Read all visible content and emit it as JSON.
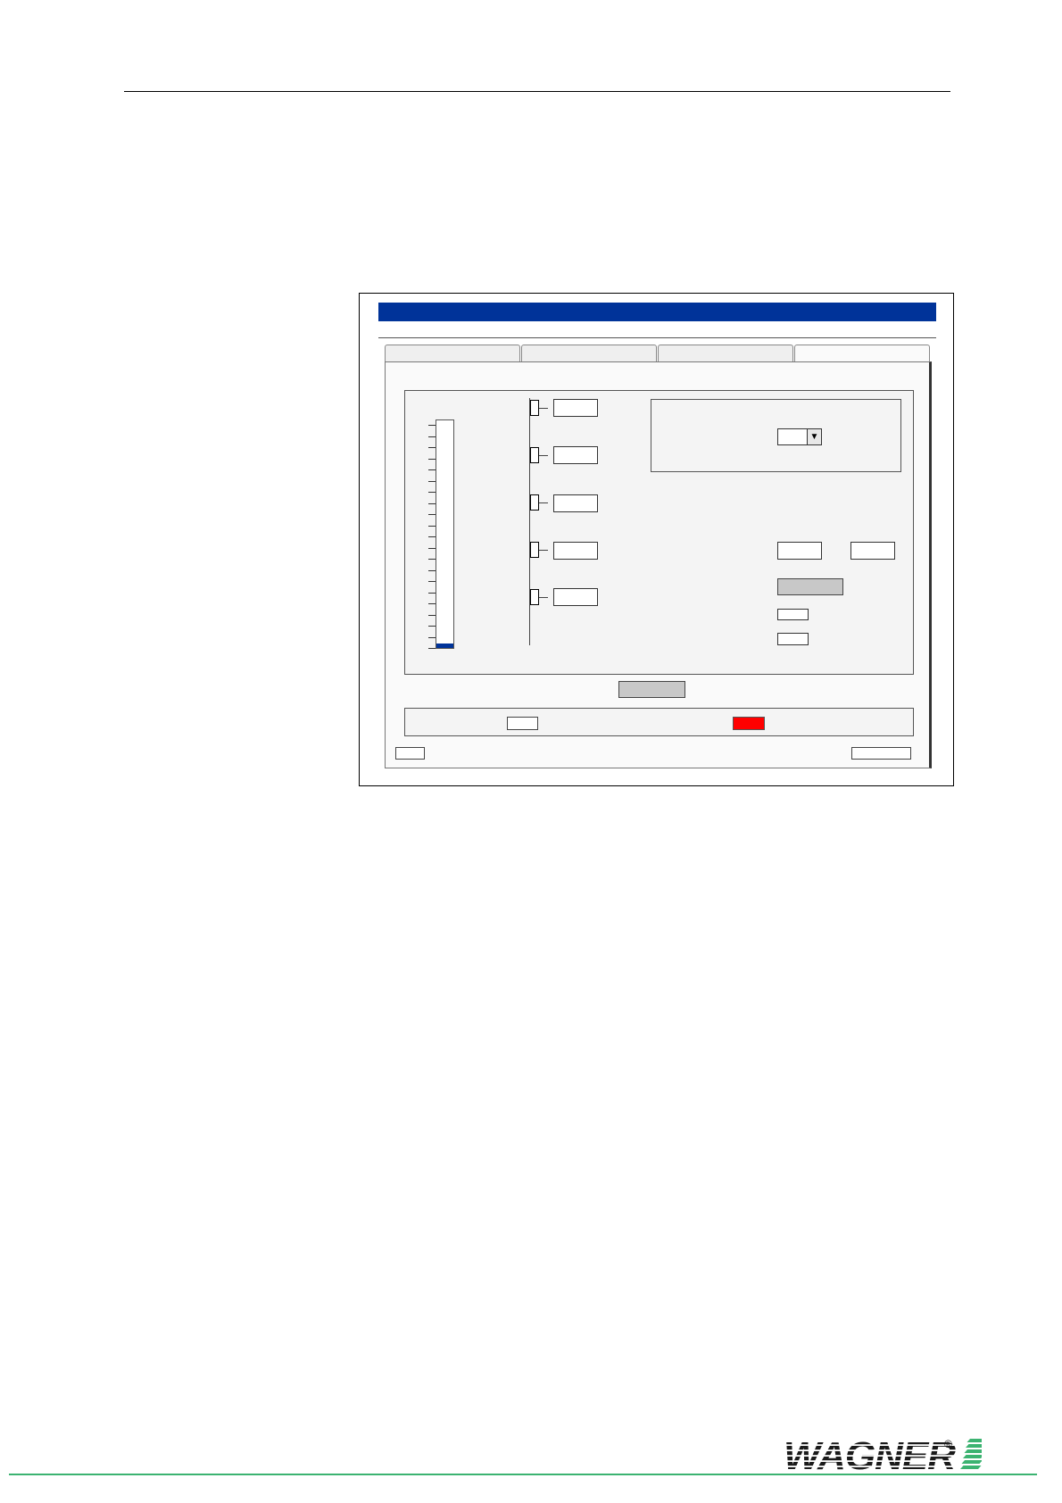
{
  "logo": {
    "text": "WAGNER",
    "registered_mark": "®",
    "color": "#1a1a1a",
    "accent_color": "#3cb371"
  },
  "screenshot": {
    "title_bar_color": "#003399",
    "level_indicator": {
      "fraction": 0.02,
      "color": "#003399"
    },
    "alarm_indicator_color": "#ff0000"
  }
}
